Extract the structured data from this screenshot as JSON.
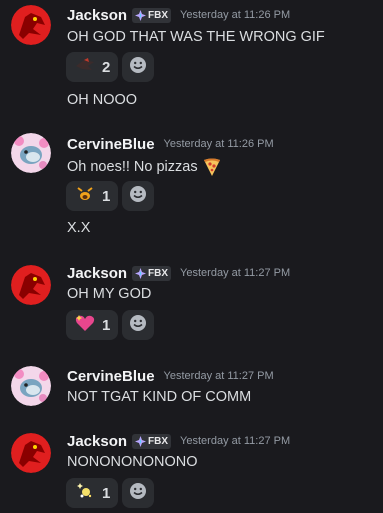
{
  "colors": {
    "background": "#1a1a1e",
    "username": "#f2f3f5",
    "message_text": "#dbdee1",
    "timestamp": "#949ba4",
    "reaction_bg": "#2b2d31"
  },
  "messages": [
    {
      "author": "Jackson",
      "tag": "FBX",
      "timestamp": "Yesterday at 11:26 PM",
      "avatar": "red-dragon-avatar",
      "lines": [
        "OH GOD THAT WAS THE WRONG GIF",
        "OH NOOO"
      ],
      "reactions": [
        {
          "emoji": "bird-emoji",
          "count": "2"
        }
      ]
    },
    {
      "author": "CervineBlue",
      "timestamp": "Yesterday at 11:26 PM",
      "avatar": "blue-creature-flowers-avatar",
      "lines": [
        "Oh noes!! No pizzas",
        "X.X"
      ],
      "line_emoji": "pizza-emoji",
      "reactions": [
        {
          "emoji": "crying-face-emoji",
          "count": "1"
        }
      ]
    },
    {
      "author": "Jackson",
      "tag": "FBX",
      "timestamp": "Yesterday at 11:27 PM",
      "avatar": "red-dragon-avatar",
      "lines": [
        "OH MY GOD"
      ],
      "reactions": [
        {
          "emoji": "sparkling-heart-emoji",
          "count": "1"
        }
      ]
    },
    {
      "author": "CervineBlue",
      "timestamp": "Yesterday at 11:27 PM",
      "avatar": "blue-creature-flowers-avatar",
      "lines": [
        "NOT TGAT KIND OF COMM"
      ]
    },
    {
      "author": "Jackson",
      "tag": "FBX",
      "timestamp": "Yesterday at 11:27 PM",
      "avatar": "red-dragon-avatar",
      "lines": [
        "NONONONONONO"
      ],
      "reactions": [
        {
          "emoji": "sparkle-sticker-emoji",
          "count": "1"
        }
      ]
    }
  ]
}
